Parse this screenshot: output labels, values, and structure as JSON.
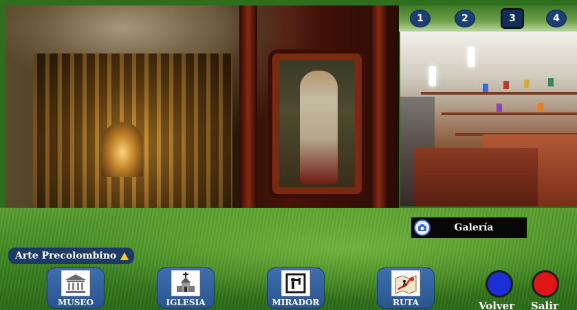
{
  "tabs": [
    "1",
    "2",
    "3",
    "4"
  ],
  "active_tab": "3",
  "gallery_badge": {
    "label": "Galería",
    "icon": "camera-icon"
  },
  "section": {
    "label": "Arte Precolombino",
    "icon": "triangle-icon",
    "icon_color": "#f3d21a"
  },
  "nav": [
    {
      "label": "MUSEO",
      "icon": "museum-icon"
    },
    {
      "label": "IGLESIA",
      "icon": "church-icon"
    },
    {
      "label": "MIRADOR",
      "icon": "viewpoint-icon"
    },
    {
      "label": "RUTA",
      "icon": "route-map-icon"
    }
  ],
  "actions": {
    "back": {
      "label": "Volver",
      "color": "#1a2fd6"
    },
    "exit": {
      "label": "Salir",
      "color": "#e01616"
    }
  },
  "colors": {
    "nav_button": "#2f5d9c",
    "badge_bg": "#080808",
    "tab_circle": "#1d3f76"
  }
}
